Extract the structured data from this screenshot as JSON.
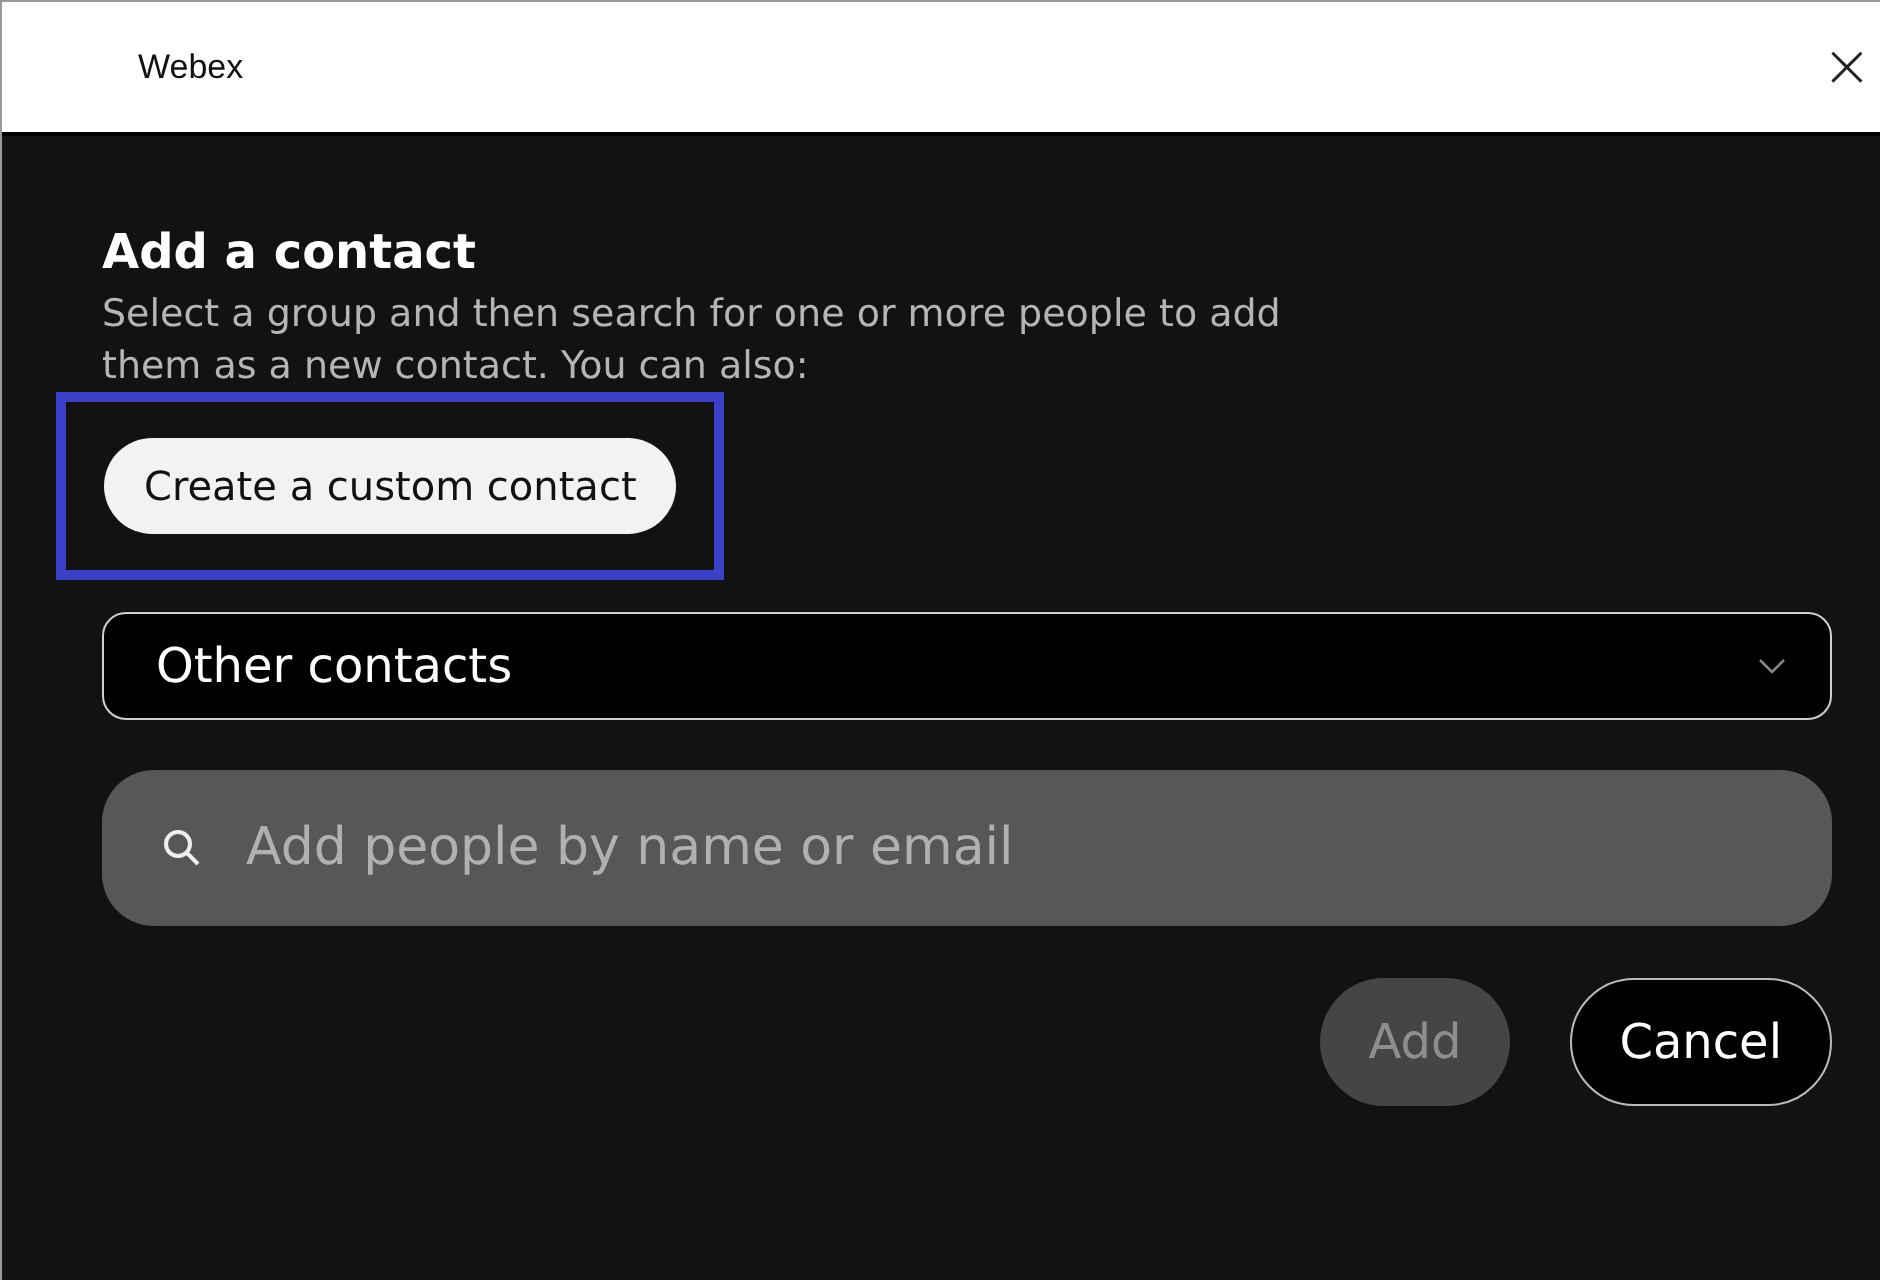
{
  "window": {
    "title": "Webex",
    "close": "×"
  },
  "heading": "Add a contact",
  "description": "Select a group and then search for one or more people to add them as a new contact. You can also:",
  "custom_contact_button": {
    "label": "Create a custom contact",
    "focused": true
  },
  "group_dropdown": {
    "value": "Other contacts"
  },
  "search": {
    "placeholder": "Add people by name or email"
  },
  "buttons": [
    {
      "label": "Add",
      "kind": "primary",
      "disabled": true
    },
    {
      "label": "Cancel",
      "kind": "outline",
      "disabled": false
    }
  ]
}
